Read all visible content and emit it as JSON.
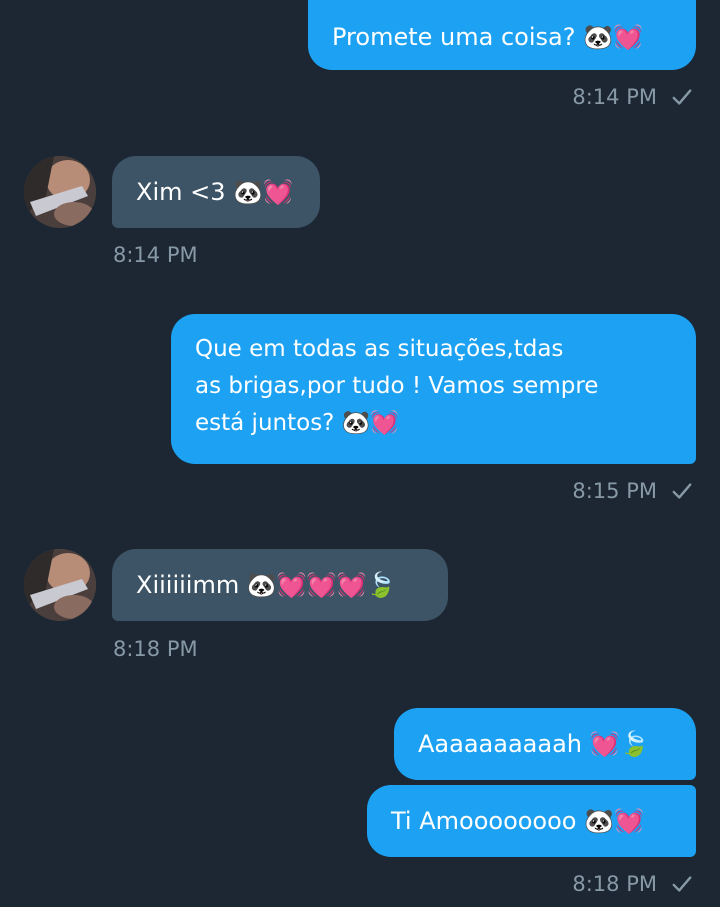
{
  "colors": {
    "background": "#1c2733",
    "outgoing_bubble": "#1da1f2",
    "incoming_bubble": "#3d5466",
    "timestamp": "#8899a6"
  },
  "messages": [
    {
      "direction": "outgoing",
      "text": "Promete uma coisa? 🐼💓",
      "time": "8:14 PM",
      "status_icon": "checkmark-icon"
    },
    {
      "direction": "incoming",
      "text": "Xim <3 🐼💓",
      "time": "8:14 PM"
    },
    {
      "direction": "outgoing",
      "lines": [
        "Que em todas as situações,tdas",
        "as brigas,por tudo ! Vamos sempre",
        "está juntos? 🐼💓"
      ],
      "time": "8:15 PM",
      "status_icon": "checkmark-icon"
    },
    {
      "direction": "incoming",
      "text": "Xiiiiiimm 🐼💓💓💓🍃",
      "time": "8:18 PM"
    },
    {
      "direction": "outgoing",
      "text": "Aaaaaaaaaah 💓🍃"
    },
    {
      "direction": "outgoing",
      "text": "Ti Amoooooooo 🐼💓",
      "time": "8:18 PM",
      "status_icon": "checkmark-icon"
    }
  ]
}
